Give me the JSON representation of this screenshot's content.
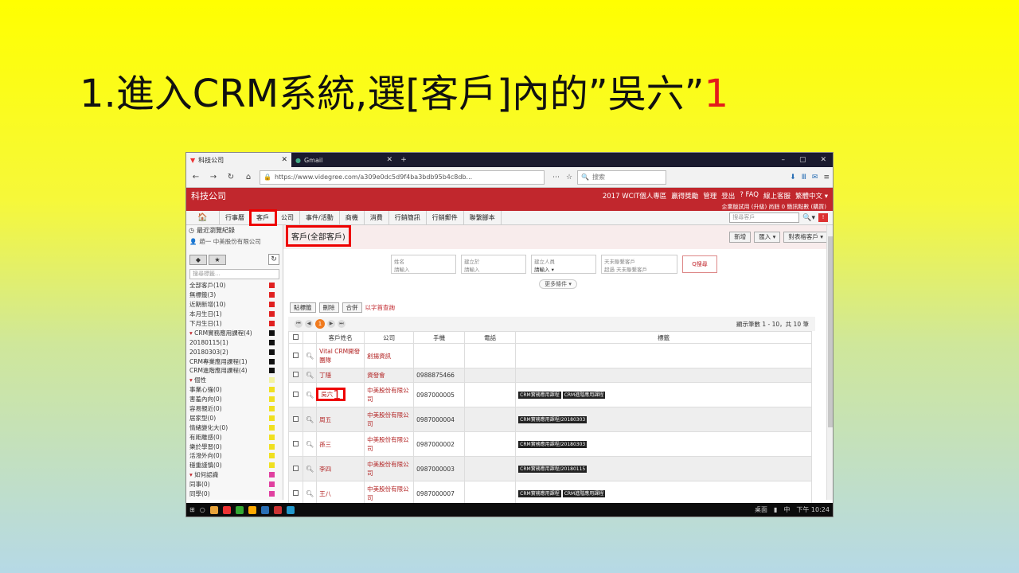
{
  "slide": {
    "title_main": "1.進入CRM系統,選[客戶]內的”吳六”",
    "title_num": "1"
  },
  "browser": {
    "tabs": [
      {
        "label": "科技公司",
        "active": true
      },
      {
        "label": "Gmail",
        "active": false
      }
    ],
    "url": "https://www.videgree.com/a309e0dc5d9f4ba3bdb95b4c8db...",
    "search_placeholder": "搜索"
  },
  "app": {
    "title": "科技公司",
    "top_links": [
      "2017 WCIT個人專區",
      "贏得獎勵",
      "管理",
      "登出",
      "? FAQ",
      "線上客服",
      "繁體中文 ▾"
    ],
    "sub_line": "企業版試用 (升級)  尚餘 0 簡訊點數 (購買)"
  },
  "menu": {
    "home": "🏠",
    "items": [
      "行事曆",
      "客戶",
      "公司",
      "事件/活動",
      "商機",
      "消費",
      "行銷簡訊",
      "行銷郵件",
      "聯繫腳本"
    ],
    "search_placeholder": "搜尋客戶"
  },
  "sidebar": {
    "recent": "最近瀏覽紀錄",
    "recent_user": "趙一  中美股份有限公司",
    "search_placeholder": "搜尋標籤...",
    "items": [
      {
        "label": "全部客戶(10)",
        "color": "#e02020",
        "group": false
      },
      {
        "label": "無標籤(3)",
        "color": "#e02020",
        "group": false
      },
      {
        "label": "近期新增(10)",
        "color": "#e02020",
        "group": false
      },
      {
        "label": "本月生日(1)",
        "color": "#e02020",
        "group": false
      },
      {
        "label": "下月生日(1)",
        "color": "#e02020",
        "group": false
      },
      {
        "label": "CRM實務應用課程(4)",
        "color": "#111111",
        "group": true
      },
      {
        "label": "20180115(1)",
        "color": "#111111",
        "group": false
      },
      {
        "label": "20180303(2)",
        "color": "#111111",
        "group": false
      },
      {
        "label": "CRM專業應用課程(1)",
        "color": "#111111",
        "group": false
      },
      {
        "label": "CRM進階應用課程(4)",
        "color": "#111111",
        "group": false
      },
      {
        "label": "個性",
        "color": "#f3f3a0",
        "group": true
      },
      {
        "label": "事業心強(0)",
        "color": "#f0e020",
        "group": false
      },
      {
        "label": "害羞內向(0)",
        "color": "#f0e020",
        "group": false
      },
      {
        "label": "容易親近(0)",
        "color": "#f0e020",
        "group": false
      },
      {
        "label": "居家型(0)",
        "color": "#f0e020",
        "group": false
      },
      {
        "label": "情緒變化大(0)",
        "color": "#f0e020",
        "group": false
      },
      {
        "label": "有距離感(0)",
        "color": "#f0e020",
        "group": false
      },
      {
        "label": "樂於學習(0)",
        "color": "#f0e020",
        "group": false
      },
      {
        "label": "活潑外向(0)",
        "color": "#f0e020",
        "group": false
      },
      {
        "label": "穩重謹慎(0)",
        "color": "#f0e020",
        "group": false
      },
      {
        "label": "如何認識",
        "color": "#e040a0",
        "group": true
      },
      {
        "label": "同事(0)",
        "color": "#e040a0",
        "group": false
      },
      {
        "label": "同學(0)",
        "color": "#e040a0",
        "group": false
      }
    ]
  },
  "main": {
    "crumb": "客戶(全部客戶)",
    "buttons": [
      "新增",
      "匯入 ▾",
      "對表格客戶 ▾"
    ],
    "filters": [
      {
        "label": "姓名",
        "value": "請輸入"
      },
      {
        "label": "建立於",
        "value": "請輸入"
      },
      {
        "label": "建立人員",
        "value": "請輸入 ▾"
      },
      {
        "label": "天未聯繫客戶",
        "value": "超過  天未聯繫客戶"
      }
    ],
    "search_btn": "Q搜尋",
    "more": "更多條件 ▾",
    "actions": [
      "貼標籤",
      "刪除",
      "合併"
    ],
    "action_link": "以字首查詢",
    "page": "1",
    "pager_info": "顯示筆數 1 - 10，共 10 筆",
    "columns": [
      "客戶姓名",
      "公司",
      "手機",
      "電話",
      "標籤"
    ],
    "rows": [
      {
        "name": "Vital CRM開發團隊",
        "company": "創揚資訊",
        "mobile": "",
        "phone": "",
        "tags": []
      },
      {
        "name": "丁隱",
        "company": "資發會",
        "mobile": "0988875466",
        "phone": "",
        "tags": []
      },
      {
        "name": "吳六",
        "company": "中美股份有限公司",
        "mobile": "0987000005",
        "phone": "",
        "tags": [
          "CRM實務應用課程",
          "CRM進階應用課程"
        ],
        "highlight": true,
        "mark": "1"
      },
      {
        "name": "周五",
        "company": "中美股份有限公司",
        "mobile": "0987000004",
        "phone": "",
        "tags": [
          "CRM實務應用課程/20180303"
        ]
      },
      {
        "name": "孫三",
        "company": "中美股份有限公司",
        "mobile": "0987000002",
        "phone": "",
        "tags": [
          "CRM實務應用課程/20180303"
        ]
      },
      {
        "name": "李四",
        "company": "中美股份有限公司",
        "mobile": "0987000003",
        "phone": "",
        "tags": [
          "CRM實務應用課程/20180115"
        ]
      },
      {
        "name": "王八",
        "company": "中美股份有限公司",
        "mobile": "0987000007",
        "phone": "",
        "tags": [
          "CRM實務應用課程",
          "CRM進階應用課程"
        ]
      }
    ],
    "tag_label": "標籤"
  },
  "taskbar": {
    "desktop": "桌面",
    "lang": "中",
    "time": "下午 10:24"
  }
}
